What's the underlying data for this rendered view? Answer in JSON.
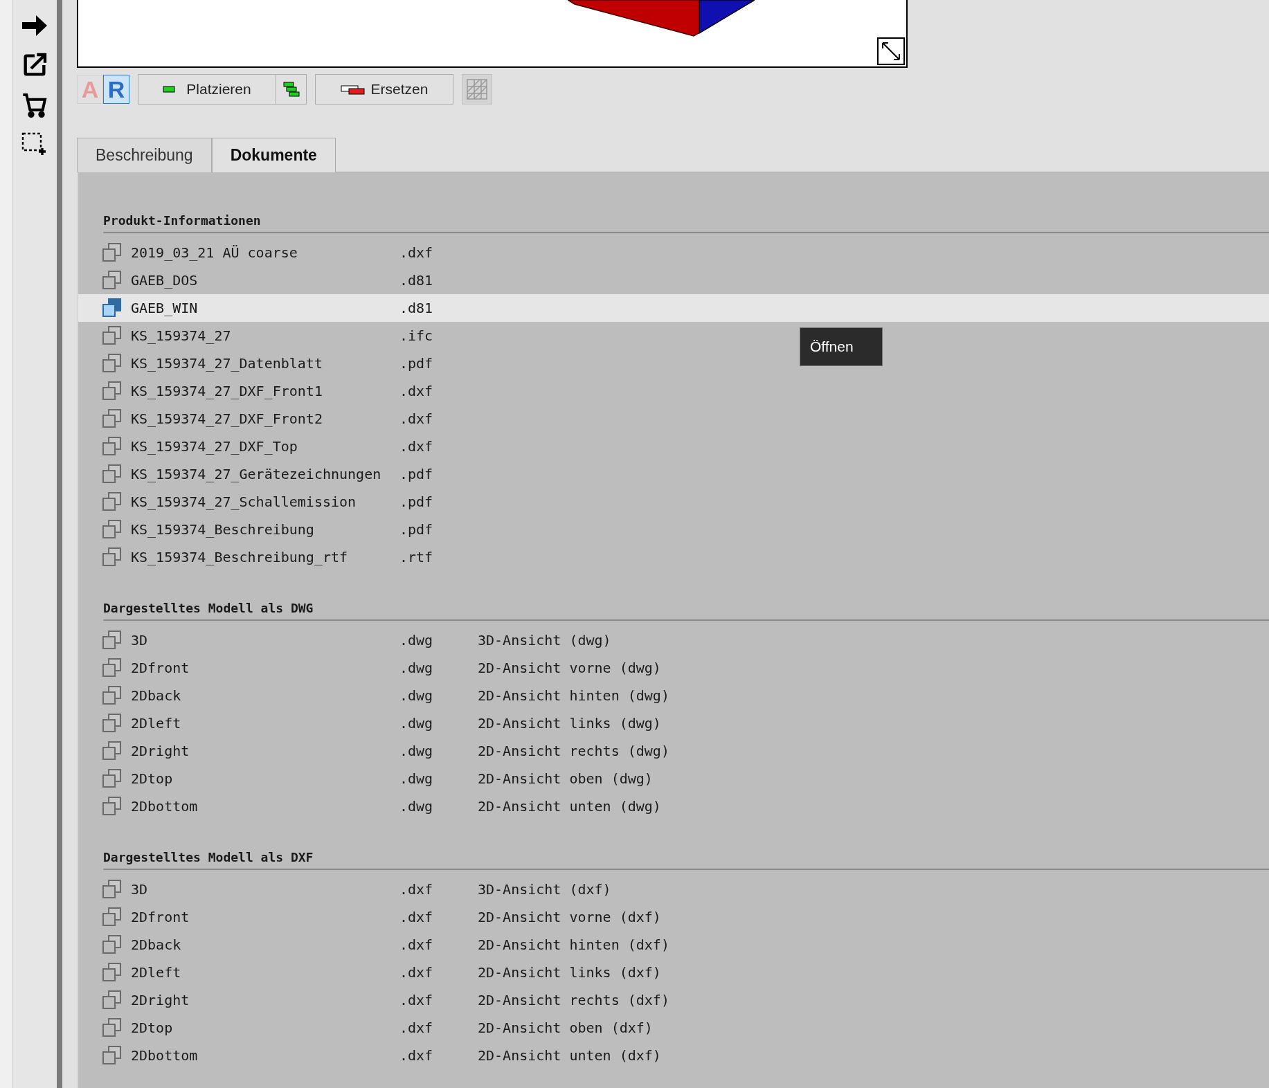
{
  "toolbar": {
    "toggles": [
      {
        "label": "A",
        "selected": false
      },
      {
        "label": "R",
        "selected": true
      }
    ],
    "place_button": "Platzieren",
    "replace_button": "Ersetzen"
  },
  "tabs": [
    {
      "label": "Beschreibung",
      "selected": false
    },
    {
      "label": "Dokumente",
      "selected": true
    }
  ],
  "sections": [
    {
      "title": "Produkt-Informationen",
      "rows": [
        {
          "name": "2019_03_21 AÜ coarse",
          "ext": ".dxf",
          "selected": false
        },
        {
          "name": "GAEB_DOS",
          "ext": ".d81",
          "selected": false
        },
        {
          "name": "GAEB_WIN",
          "ext": ".d81",
          "selected": true
        },
        {
          "name": "KS_159374_27",
          "ext": ".ifc",
          "selected": false
        },
        {
          "name": "KS_159374_27_Datenblatt",
          "ext": ".pdf",
          "selected": false
        },
        {
          "name": "KS_159374_27_DXF_Front1",
          "ext": ".dxf",
          "selected": false
        },
        {
          "name": "KS_159374_27_DXF_Front2",
          "ext": ".dxf",
          "selected": false
        },
        {
          "name": "KS_159374_27_DXF_Top",
          "ext": ".dxf",
          "selected": false
        },
        {
          "name": "KS_159374_27_Gerätezeichnungen",
          "ext": ".pdf",
          "selected": false
        },
        {
          "name": "KS_159374_27_Schallemission",
          "ext": ".pdf",
          "selected": false
        },
        {
          "name": "KS_159374_Beschreibung",
          "ext": ".pdf",
          "selected": false
        },
        {
          "name": "KS_159374_Beschreibung_rtf",
          "ext": ".rtf",
          "selected": false
        }
      ]
    },
    {
      "title": "Dargestelltes Modell als DWG",
      "rows": [
        {
          "name": "3D",
          "ext": ".dwg",
          "description": "3D-Ansicht (dwg)",
          "selected": false
        },
        {
          "name": "2Dfront",
          "ext": ".dwg",
          "description": "2D-Ansicht vorne (dwg)",
          "selected": false
        },
        {
          "name": "2Dback",
          "ext": ".dwg",
          "description": "2D-Ansicht hinten (dwg)",
          "selected": false
        },
        {
          "name": "2Dleft",
          "ext": ".dwg",
          "description": "2D-Ansicht links (dwg)",
          "selected": false
        },
        {
          "name": "2Dright",
          "ext": ".dwg",
          "description": "2D-Ansicht rechts (dwg)",
          "selected": false
        },
        {
          "name": "2Dtop",
          "ext": ".dwg",
          "description": "2D-Ansicht oben (dwg)",
          "selected": false
        },
        {
          "name": "2Dbottom",
          "ext": ".dwg",
          "description": "2D-Ansicht unten (dwg)",
          "selected": false
        }
      ]
    },
    {
      "title": "Dargestelltes Modell als DXF",
      "rows": [
        {
          "name": "3D",
          "ext": ".dxf",
          "description": "3D-Ansicht (dxf)",
          "selected": false
        },
        {
          "name": "2Dfront",
          "ext": ".dxf",
          "description": "2D-Ansicht vorne (dxf)",
          "selected": false
        },
        {
          "name": "2Dback",
          "ext": ".dxf",
          "description": "2D-Ansicht hinten (dxf)",
          "selected": false
        },
        {
          "name": "2Dleft",
          "ext": ".dxf",
          "description": "2D-Ansicht links (dxf)",
          "selected": false
        },
        {
          "name": "2Dright",
          "ext": ".dxf",
          "description": "2D-Ansicht rechts (dxf)",
          "selected": false
        },
        {
          "name": "2Dtop",
          "ext": ".dxf",
          "description": "2D-Ansicht oben (dxf)",
          "selected": false
        },
        {
          "name": "2Dbottom",
          "ext": ".dxf",
          "description": "2D-Ansicht unten (dxf)",
          "selected": false
        }
      ]
    }
  ],
  "tooltip": "Öffnen"
}
